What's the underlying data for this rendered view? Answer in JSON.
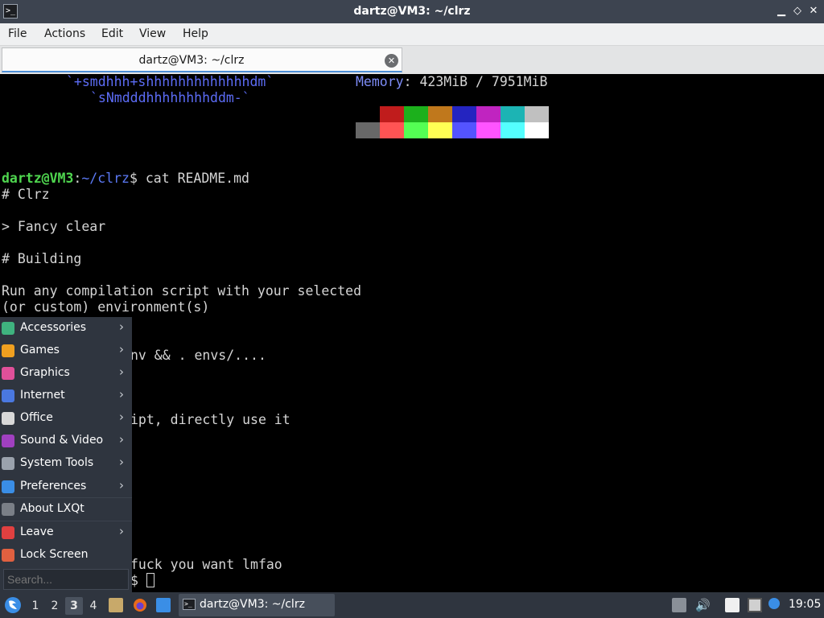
{
  "window": {
    "title": "dartz@VM3: ~/clrz",
    "controls": {
      "minimize": "▁",
      "restore": "◇",
      "close": "✕"
    }
  },
  "menubar": [
    "File",
    "Actions",
    "Edit",
    "View",
    "Help"
  ],
  "tab": {
    "label": "dartz@VM3: ~/clrz"
  },
  "terminal": {
    "logo_line_1": "`+smdhhh+shhhhhhhhhhhhhdm`",
    "logo_line_2": "`sNmdddhhhhhhhhddm-`",
    "memory_label": "Memory",
    "memory_value": ": 423MiB / 7951MiB",
    "palette_top": [
      "#000000",
      "#c01c1c",
      "#1cb01c",
      "#c0781c",
      "#2424c0",
      "#c024c0",
      "#1cb4b4",
      "#c0c0c0"
    ],
    "palette_bottom": [
      "#686868",
      "#ff5454",
      "#54ff54",
      "#ffff54",
      "#5454ff",
      "#ff54ff",
      "#54ffff",
      "#ffffff"
    ],
    "prompt_user": "dartz@VM3",
    "prompt_sep": ":",
    "prompt_path": "~/clrz",
    "prompt_dollar": "$ ",
    "command": "cat README.md",
    "lines": [
      "# Clrz",
      "",
      "> Fancy clear",
      "",
      "# Building",
      "",
      "Run any compilation script with your selected",
      "(or custom) environment(s)"
    ],
    "partial_1": "nv && . envs/....",
    "partial_2": "ipt, directly use it",
    "partial_3": "fuck you want lmfao",
    "partial_prompt": "$ "
  },
  "startmenu": {
    "items": [
      {
        "label": "Accessories",
        "icon": "accessories-icon",
        "color": "#3fb37f",
        "submenu": true
      },
      {
        "label": "Games",
        "icon": "games-icon",
        "color": "#f0a020",
        "submenu": true
      },
      {
        "label": "Graphics",
        "icon": "graphics-icon",
        "color": "#e0509a",
        "submenu": true
      },
      {
        "label": "Internet",
        "icon": "internet-icon",
        "color": "#4a78e0",
        "submenu": true
      },
      {
        "label": "Office",
        "icon": "office-icon",
        "color": "#d8d8d8",
        "submenu": true
      },
      {
        "label": "Sound & Video",
        "icon": "sound-video-icon",
        "color": "#a040c0",
        "submenu": true
      },
      {
        "label": "System Tools",
        "icon": "system-tools-icon",
        "color": "#9aa2ad",
        "submenu": true
      },
      {
        "label": "Preferences",
        "icon": "preferences-icon",
        "color": "#3a8ee6",
        "submenu": true
      },
      {
        "label": "About LXQt",
        "icon": "info-icon",
        "color": "#7a7f87",
        "submenu": false
      },
      {
        "label": "Leave",
        "icon": "power-icon",
        "color": "#e04040",
        "submenu": true
      },
      {
        "label": "Lock Screen",
        "icon": "lock-icon",
        "color": "#e06040",
        "submenu": false
      }
    ],
    "search_placeholder": "Search..."
  },
  "taskbar": {
    "workspaces": [
      "1",
      "2",
      "3",
      "4"
    ],
    "active_workspace": "3",
    "task_label": "dartz@VM3: ~/clrz",
    "clock": "19:05"
  }
}
